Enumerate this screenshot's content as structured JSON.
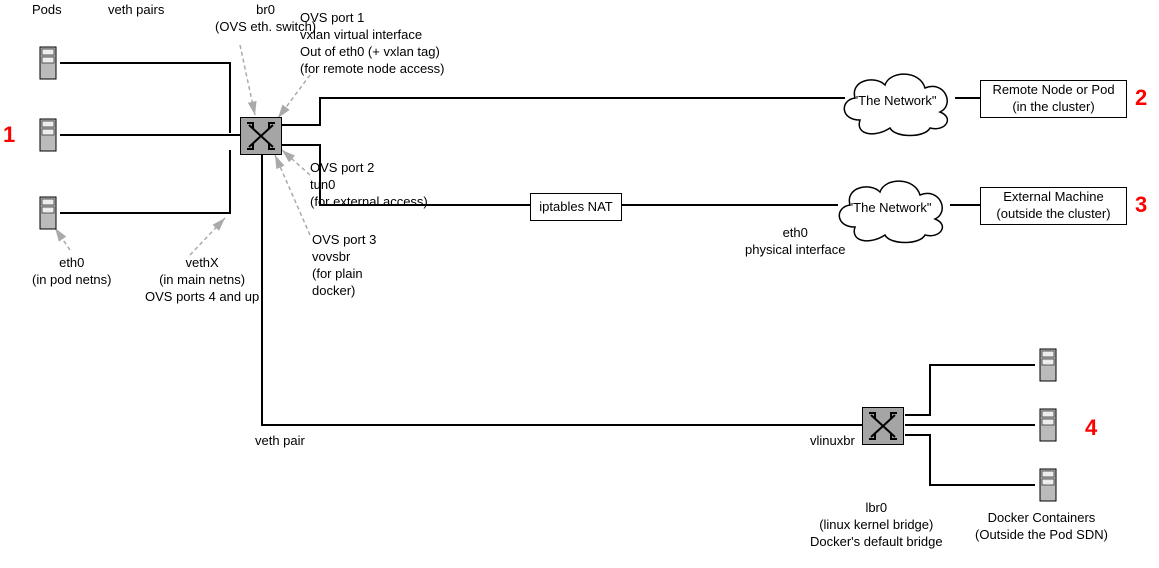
{
  "headers": {
    "pods": "Pods",
    "veth_pairs": "veth pairs",
    "br0": "br0\n(OVS eth. switch)"
  },
  "ovs_ports": {
    "port1": "OVS port 1\nvxlan virtual interface\nOut of eth0 (+ vxlan tag)\n(for remote node access)",
    "port2": "OVS port 2\ntun0\n(for external access)",
    "port3": "OVS port 3\nvovsbr\n(for plain\ndocker)"
  },
  "left_notes": {
    "eth0": "eth0\n(in pod netns)",
    "vethX": "vethX\n(in main netns)\nOVS ports 4 and up"
  },
  "mid": {
    "iptables": "iptables NAT",
    "eth0_phys": "eth0\nphysical interface"
  },
  "clouds": {
    "net1": "\"The Network\"",
    "net2": "\"The Network\""
  },
  "right_boxes": {
    "remote_node": "Remote Node or Pod\n(in the cluster)",
    "external": "External Machine\n(outside the cluster)"
  },
  "bottom": {
    "veth_pair": "veth pair",
    "vlinuxbr": "vlinuxbr",
    "lbr0": "lbr0\n(linux kernel bridge)\nDocker's default bridge",
    "docker_containers": "Docker Containers\n(Outside the Pod SDN)"
  },
  "nums": {
    "n1": "1",
    "n2": "2",
    "n3": "3",
    "n4": "4"
  }
}
